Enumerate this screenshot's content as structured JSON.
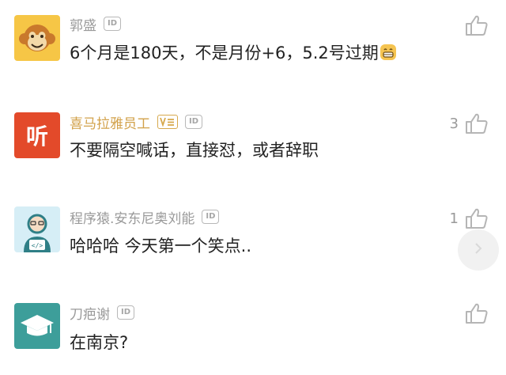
{
  "comments": [
    {
      "username": "郭盛",
      "id_badge": "ID",
      "text": "6个月是180天，不是月份+6，5.2号过期",
      "likes": ""
    },
    {
      "username": "喜马拉雅员工",
      "id_badge": "ID",
      "text": "不要隔空喊话，直接怼，或者辞职",
      "likes": "3",
      "avatar_text": "听"
    },
    {
      "username": "程序猿.安东尼奥刘能",
      "id_badge": "ID",
      "text": "哈哈哈 今天第一个笑点..",
      "likes": "1",
      "avatar_text": "</>"
    },
    {
      "username": "刀疤谢",
      "id_badge": "ID",
      "text": "在南京?",
      "likes": ""
    }
  ],
  "colors": {
    "username": "#9a9a9a",
    "staff_username": "#d2a14a",
    "text": "#222222",
    "ximalaya_red": "#e34a2a",
    "teal_avatar": "#3d9e9a"
  }
}
